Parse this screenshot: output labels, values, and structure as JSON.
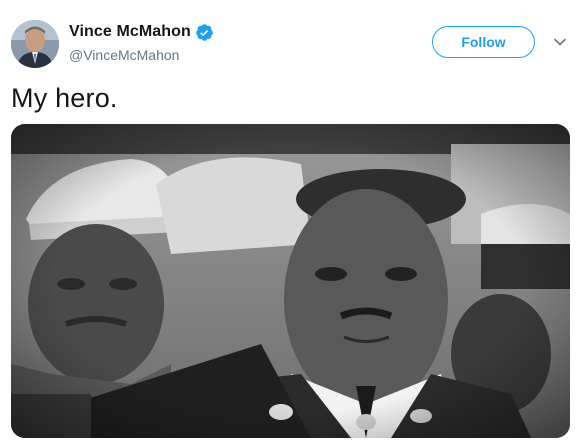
{
  "author": {
    "display_name": "Vince McMahon",
    "handle": "@VinceMcMahon",
    "verified": true,
    "verified_icon": "verified-badge-icon"
  },
  "actions": {
    "follow_label": "Follow",
    "more_icon": "chevron-down-icon"
  },
  "tweet": {
    "text": "My hero."
  },
  "media": {
    "type": "video-still",
    "palette": "grayscale"
  },
  "colors": {
    "accent": "#1da1f2",
    "text_primary": "#14171a",
    "text_secondary": "#657786"
  }
}
